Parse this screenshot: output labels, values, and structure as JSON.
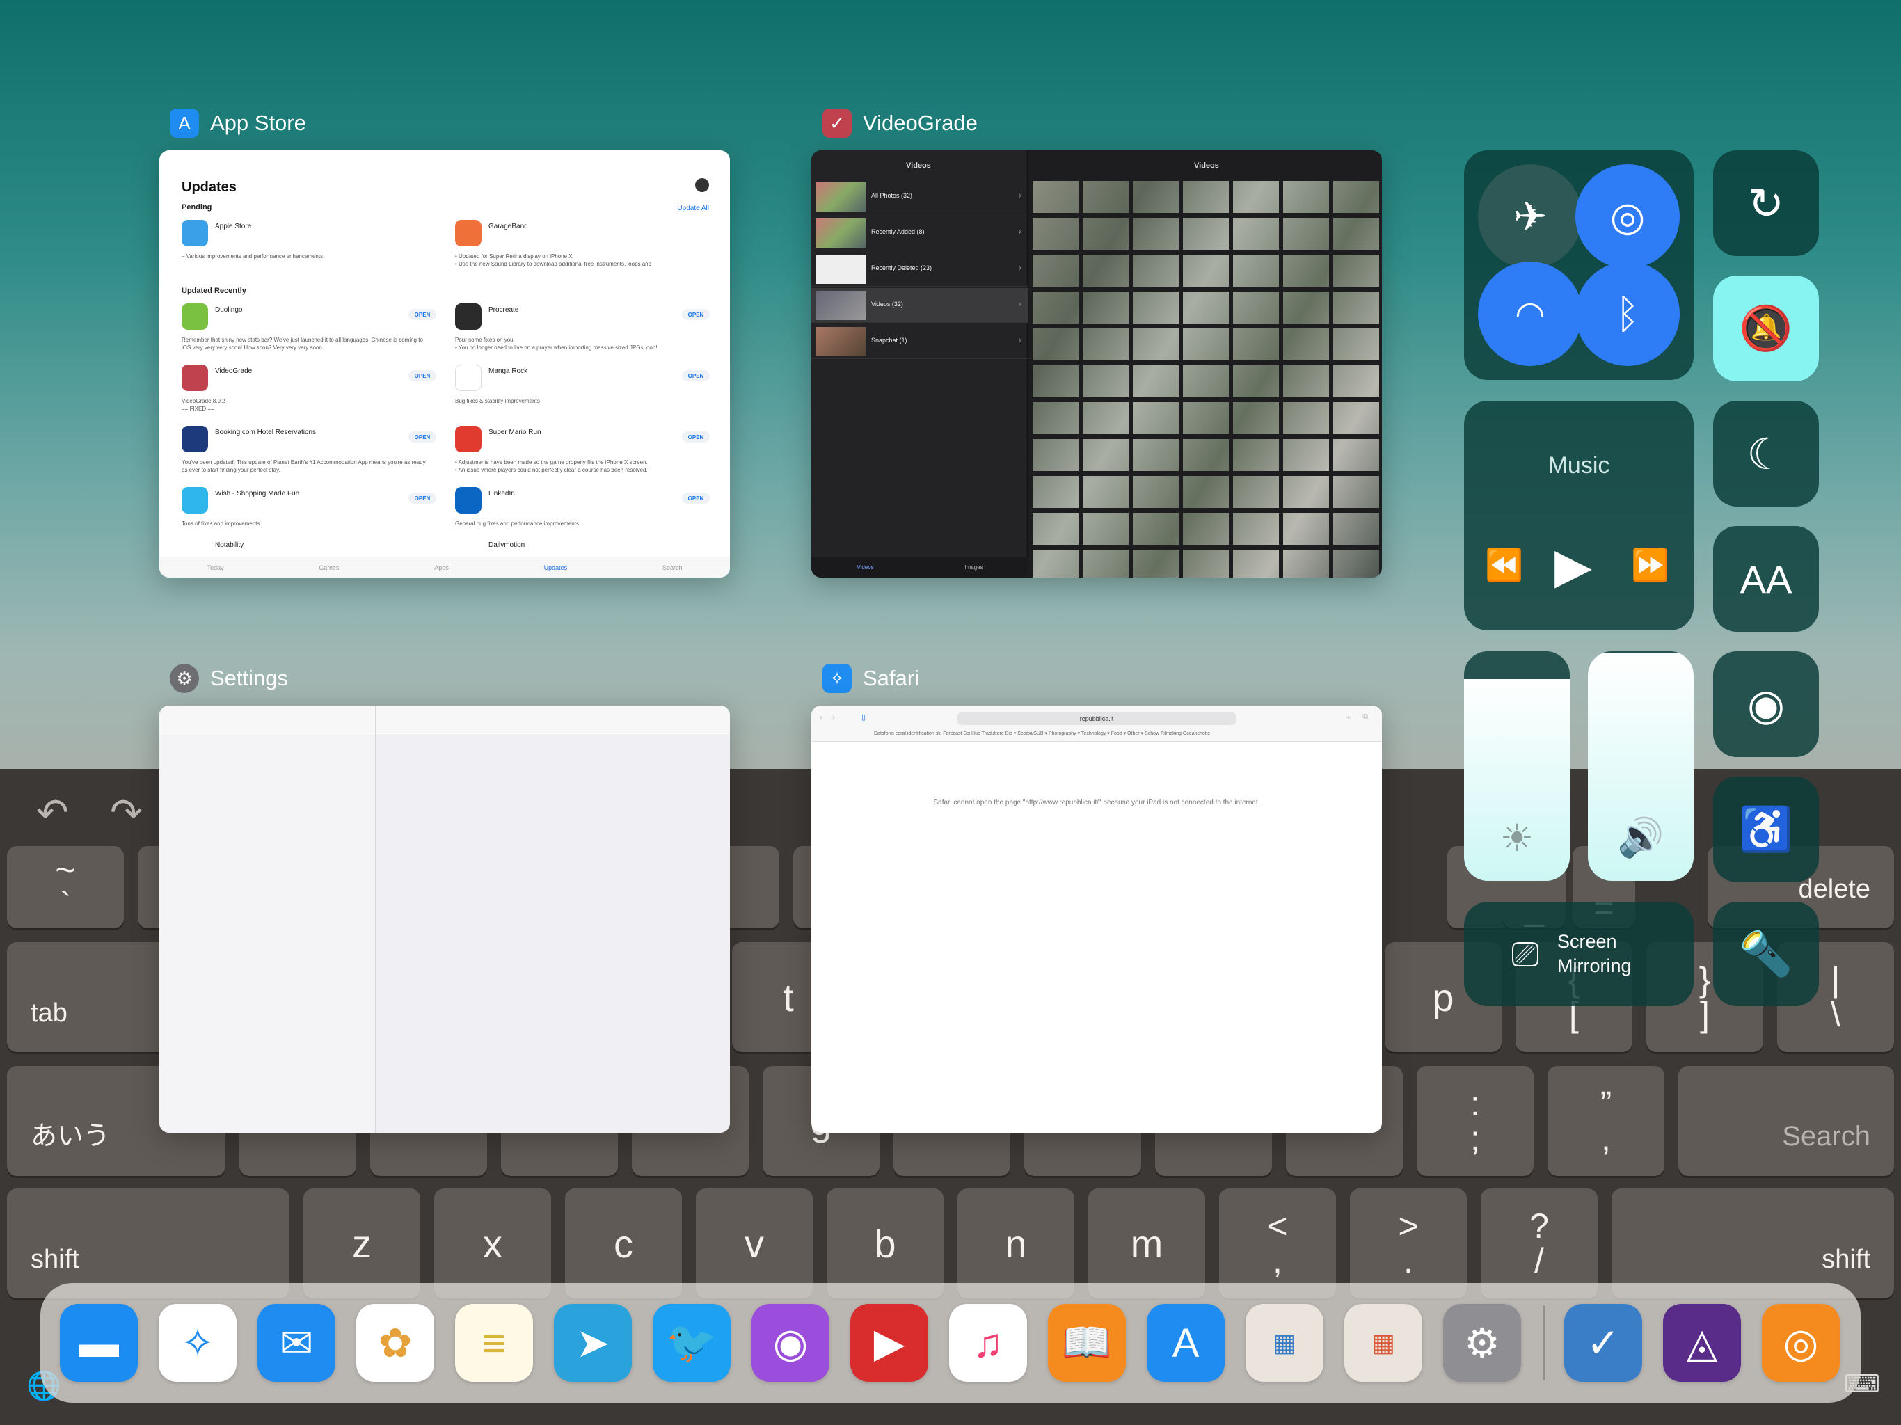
{
  "keyboard": {
    "undo_icon": "undo-icon",
    "redo_icon": "redo-icon",
    "keys": {
      "tilde": "~",
      "backtick": "`",
      "tab": "tab",
      "t": "t",
      "p": "p",
      "brace_l": "{",
      "brace_r": "}",
      "bracket_l": "[",
      "bracket_r": "]",
      "pipe": "|",
      "backslash": "\\",
      "delete": "delete",
      "kana": "あいう",
      "g": "g",
      "colon": ":",
      "semicolon": ";",
      "dquote": "”",
      "squote": ",",
      "search": "Search",
      "shift_left": "shift",
      "z": "z",
      "x": "x",
      "c": "c",
      "v": "v",
      "b": "b",
      "n": "n",
      "m": "m",
      "lt": "<",
      "comma": ",",
      "gt": ">",
      "period": ".",
      "question": "?",
      "slash": "/",
      "shift_right": "shift",
      "minus": "_",
      "equals": "="
    }
  },
  "app_switcher": {
    "apps": [
      {
        "name": "App Store",
        "icon": "app-store-icon",
        "color": "#1e8cf0"
      },
      {
        "name": "VideoGrade",
        "icon": "videograde-icon",
        "color": "#c0424f"
      },
      {
        "name": "Settings",
        "icon": "gear-icon",
        "color": "#6d6d72"
      },
      {
        "name": "Safari",
        "icon": "compass-icon",
        "color": "#1e8cf0"
      }
    ],
    "app_store": {
      "title": "Updates",
      "pending": "Pending",
      "update_all": "Update All",
      "updated_recently": "Updated Recently",
      "pending_items": [
        {
          "name": "Apple Store",
          "desc": "– Various improvements and performance enhancements.",
          "color": "#3aa0e8"
        },
        {
          "name": "GarageBand",
          "desc": "• Updated for Super Retina display on iPhone X\n• Use the new Sound Library to download additional free instruments, loops and",
          "color": "#f0703a"
        }
      ],
      "recent_items": [
        {
          "name": "Duolingo",
          "desc": "Remember that shiny new stats bar? We've just launched it to all languages. Chinese is coming to iOS very very very soon! How soon? Very very very soon.",
          "color": "#7ac142",
          "open": "OPEN"
        },
        {
          "name": "Procreate",
          "desc": "Pour some fixes on you\n• You no longer need to live on a prayer when importing massive sized JPGs, ooh!",
          "color": "#2b2b2b",
          "open": "OPEN"
        },
        {
          "name": "VideoGrade",
          "desc": "VideoGrade 8.0.2\n== FIXED ==",
          "color": "#c0424f",
          "open": "OPEN"
        },
        {
          "name": "Manga Rock",
          "desc": "Bug fixes & stability improvements",
          "color": "#ffffff",
          "open": "OPEN"
        },
        {
          "name": "Booking.com Hotel Reservations",
          "desc": "You've been updated! This update of Planet Earth's #1 Accommodation App means you're as ready as ever to start finding your perfect stay.",
          "color": "#1c3a7c",
          "open": "OPEN"
        },
        {
          "name": "Super Mario Run",
          "desc": "• Adjustments have been made so the game properly fits the iPhone X screen.\n• An issue where players could not perfectly clear a course has been resolved.",
          "color": "#e13a2e",
          "open": "OPEN"
        },
        {
          "name": "Wish - Shopping Made Fun",
          "desc": "Tons of fixes and improvements",
          "color": "#2fb7ec",
          "open": "OPEN"
        },
        {
          "name": "LinkedIn",
          "desc": "General bug fixes and performance improvements",
          "color": "#0a66c2",
          "open": "OPEN"
        }
      ],
      "partial_items": [
        "Notability",
        "Dailymotion"
      ],
      "tabs": [
        "Today",
        "Games",
        "Apps",
        "Updates",
        "Search"
      ]
    },
    "videograde": {
      "left_header": "Videos",
      "right_header": "Videos",
      "albums": [
        "All Photos (32)",
        "Recently Added (8)",
        "Recently Deleted (23)",
        "Videos (32)",
        "Snapchat (1)"
      ],
      "bottom_tabs": [
        "Videos",
        "Images"
      ]
    },
    "safari": {
      "url": "repubblica.it",
      "favorites": "Dataform   coral identification   ski Forecast   Sci Hub   Traduttore   Bio ▾   Scoaxi/SUB ▾   Photography ▾   Technology ▾   Food ▾   Other ▾   Schow   Filmaking   Oceanchotic",
      "message": "Safari cannot open the page \"http://www.repubblica.it/\" because your iPad is not connected to the internet."
    }
  },
  "control_center": {
    "airplane_icon": "airplane-icon",
    "airdrop_icon": "airdrop-icon",
    "wifi_icon": "wifi-icon",
    "bluetooth_icon": "bluetooth-icon",
    "orientation_lock_icon": "orientation-lock-icon",
    "mute_icon": "bell-slash-icon",
    "music_label": "Music",
    "do_not_disturb_icon": "moon-icon",
    "text_size_label": "AA",
    "screen_record_icon": "record-icon",
    "accessibility_icon": "accessibility-icon",
    "brightness_level": 0.88,
    "volume_level": 0.99,
    "screen_mirroring_label": "Screen\nMirroring",
    "flashlight_icon": "flashlight-icon",
    "colors": {
      "active_blue": "#2f7df6",
      "mute_active": "#88f4f2"
    }
  },
  "dock": {
    "apps": [
      {
        "name": "Files",
        "icon": "folder-icon",
        "color": "#1a8cf2"
      },
      {
        "name": "Safari",
        "icon": "compass-icon",
        "color": "#ffffff"
      },
      {
        "name": "Mail",
        "icon": "envelope-icon",
        "color": "#1e8cf0"
      },
      {
        "name": "Photos",
        "icon": "flower-icon",
        "color": "#ffffff"
      },
      {
        "name": "Notes",
        "icon": "notes-icon",
        "color": "#fff9e6"
      },
      {
        "name": "Telegram",
        "icon": "paper-plane-icon",
        "color": "#2aa3dc"
      },
      {
        "name": "Twitter",
        "icon": "bird-icon",
        "color": "#1da1f2"
      },
      {
        "name": "Podcasts",
        "icon": "podcast-icon",
        "color": "#9b4ddb"
      },
      {
        "name": "Infuse",
        "icon": "play-icon",
        "color": "#d92d2d"
      },
      {
        "name": "Music",
        "icon": "music-note-icon",
        "color": "#ffffff"
      },
      {
        "name": "Books",
        "icon": "book-icon",
        "color": "#f58b1f"
      },
      {
        "name": "App Store",
        "icon": "app-store-icon",
        "color": "#1e8cf0"
      },
      {
        "name": "Folder 1",
        "icon": "folder-grid-icon",
        "color": "#ebe4dc"
      },
      {
        "name": "Folder 2",
        "icon": "folder-grid-icon",
        "color": "#ebe4dc"
      },
      {
        "name": "Settings",
        "icon": "gear-icon",
        "color": "#8e8e93"
      },
      {
        "name": "VideoGrade",
        "icon": "videograde-icon",
        "color": "#3a7ec8"
      },
      {
        "name": "Affinity Photo",
        "icon": "aperture-icon",
        "color": "#5a2c8a"
      },
      {
        "name": "Overcast",
        "icon": "broadcast-icon",
        "color": "#f58b1f"
      }
    ]
  }
}
